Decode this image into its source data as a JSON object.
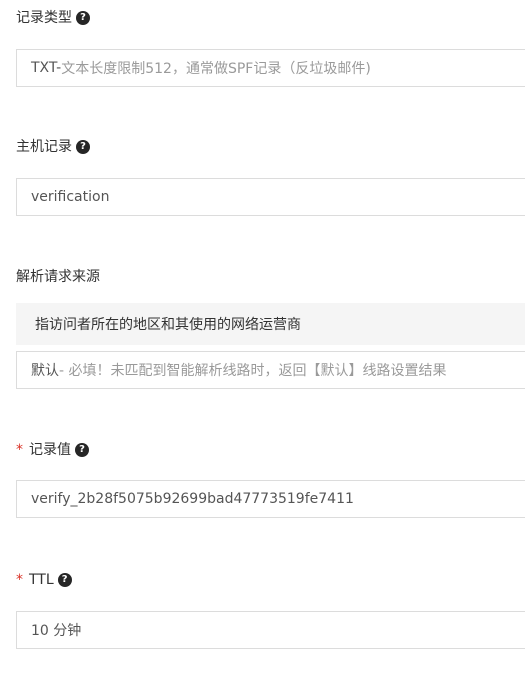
{
  "record_type": {
    "label": "记录类型",
    "help_icon": "?",
    "value_prefix": "TXT-",
    "value_desc": " 文本长度限制512，通常做SPF记录（反垃圾邮件)"
  },
  "host_record": {
    "label": "主机记录",
    "help_icon": "?",
    "value": "verification"
  },
  "resolve_source": {
    "label": "解析请求来源",
    "hint": "指访问者所在的地区和其使用的网络运营商",
    "value_prefix": "默认",
    "value_desc": " - 必填！未匹配到智能解析线路时，返回【默认】线路设置结果"
  },
  "record_value": {
    "required_mark": "*",
    "label": "记录值",
    "help_icon": "?",
    "value": "verify_2b28f5075b92699bad47773519fe7411"
  },
  "ttl": {
    "required_mark": "*",
    "label": "TTL",
    "help_icon": "?",
    "value": "10 分钟"
  },
  "colors": {
    "required": "#d93026",
    "border": "#dcdcdc",
    "hint_bg": "#f5f5f5"
  }
}
